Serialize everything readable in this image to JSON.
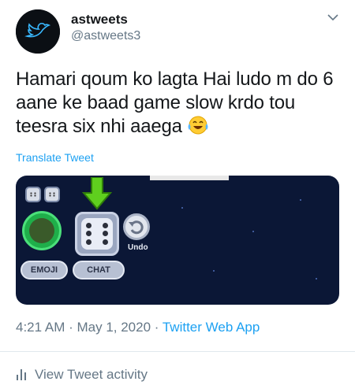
{
  "author": {
    "name": "astweets",
    "handle": "@astweets3"
  },
  "tweet": {
    "text": "Hamari qoum ko lagta Hai ludo m do 6 aane ke baad game slow krdo tou teesra six nhi aaega",
    "emoji": "face-with-tears-of-joy",
    "translate_label": "Translate Tweet"
  },
  "media": {
    "undo_label": "Undo",
    "emoji_button": "EMOJI",
    "chat_button": "CHAT"
  },
  "meta": {
    "time": "4:21 AM",
    "separator": " · ",
    "date": "May 1, 2020",
    "app": "Twitter Web App"
  },
  "activity": {
    "label": "View Tweet activity"
  },
  "colors": {
    "link": "#1da1f2",
    "secondary_text": "#657786",
    "media_background": "#0b1736"
  }
}
